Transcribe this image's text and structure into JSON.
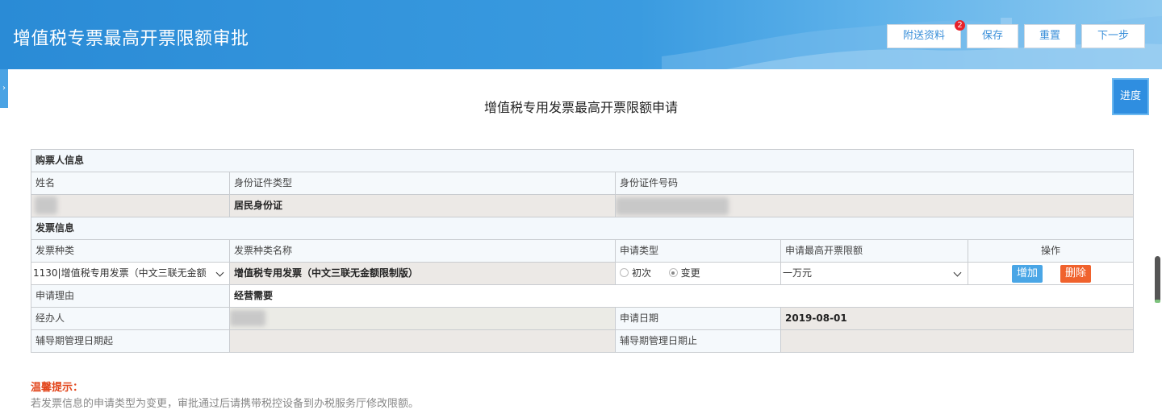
{
  "header": {
    "title": "增值税专票最高开票限额审批",
    "buttons": {
      "attachments": "附送资料",
      "attachments_badge": "2",
      "save": "保存",
      "reset": "重置",
      "next": "下一步"
    }
  },
  "side_tab": {
    "icon": "chevron-right-icon",
    "glyph": "›"
  },
  "progress_label": "进度",
  "form_title": "增值税专用发票最高开票限额申请",
  "buyer": {
    "section": "购票人信息",
    "name_label": "姓名",
    "id_type_label": "身份证件类型",
    "id_number_label": "身份证件号码",
    "id_type_value": "居民身份证"
  },
  "invoice": {
    "section": "发票信息",
    "headers": {
      "type": "发票种类",
      "type_name": "发票种类名称",
      "apply_type": "申请类型",
      "max_limit": "申请最高开票限额",
      "ops": "操作"
    },
    "type_value": "1130|增值税专用发票（中文三联无金额",
    "type_name_value": "增值税专用发票（中文三联无金额限制版）",
    "apply_options": [
      "初次",
      "变更"
    ],
    "apply_selected": "变更",
    "max_limit_value": "一万元",
    "add_button": "增加",
    "delete_button": "删除",
    "reason_label": "申请理由",
    "reason_value": "经营需要",
    "handler_label": "经办人",
    "apply_date_label": "申请日期",
    "apply_date_value": "2019-08-01",
    "guide_start_label": "辅导期管理日期起",
    "guide_end_label": "辅导期管理日期止"
  },
  "tip": {
    "title": "温馨提示：",
    "text": "若发票信息的申请类型为变更，审批通过后请携带税控设备到办税服务厅修改限额。"
  },
  "colors": {
    "header": "#2a8bd6",
    "accent_button": "#4aa6e6",
    "delete_button": "#f0622d",
    "tip_title": "#e2461c"
  }
}
